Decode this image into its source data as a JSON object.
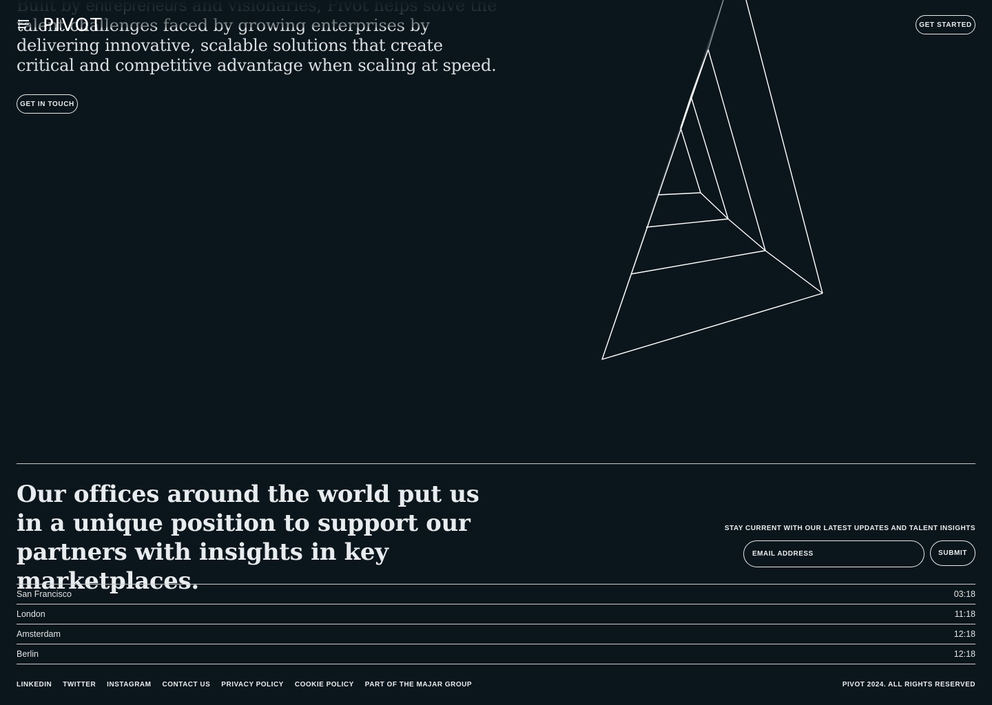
{
  "brand": {
    "logo_text": "PIVOT"
  },
  "header": {
    "menu_icon": "hamburger-menu-icon",
    "get_started_label": "GET STARTED"
  },
  "hero": {
    "text_faded_a": "Built by ",
    "text_faded_b": "entrepreneurs",
    "text_faded_c": " and visionaries, Pivot helps solve the ",
    "text_main": "talent challenges faced by growing enterprises by delivering innovative, scalable solutions that create critical and competitive advantage when scaling at speed.",
    "cta_label": "GET IN TOUCH"
  },
  "offices": {
    "heading": "Our offices around the world put us in a unique position to support our partners with insights in key marketplaces.",
    "list": [
      {
        "city": "San Francisco",
        "time": "03:18"
      },
      {
        "city": "London",
        "time": "11:18"
      },
      {
        "city": "Amsterdam",
        "time": "12:18"
      },
      {
        "city": "Berlin",
        "time": "12:18"
      }
    ]
  },
  "newsletter": {
    "label": "STAY CURRENT WITH OUR LATEST UPDATES AND TALENT INSIGHTS",
    "email_placeholder": "EMAIL ADDRESS",
    "submit_label": "SUBMIT"
  },
  "footer": {
    "links": [
      "LINKEDIN",
      "TWITTER",
      "INSTAGRAM",
      "CONTACT US",
      "PRIVACY POLICY",
      "COOKIE POLICY",
      "PART OF THE MAJAR GROUP"
    ],
    "copyright": "PIVOT 2024. ALL RIGHTS RESERVED"
  },
  "colors": {
    "background": "#0b161c",
    "foreground": "#e8ecee",
    "muted": "#7d878c"
  }
}
